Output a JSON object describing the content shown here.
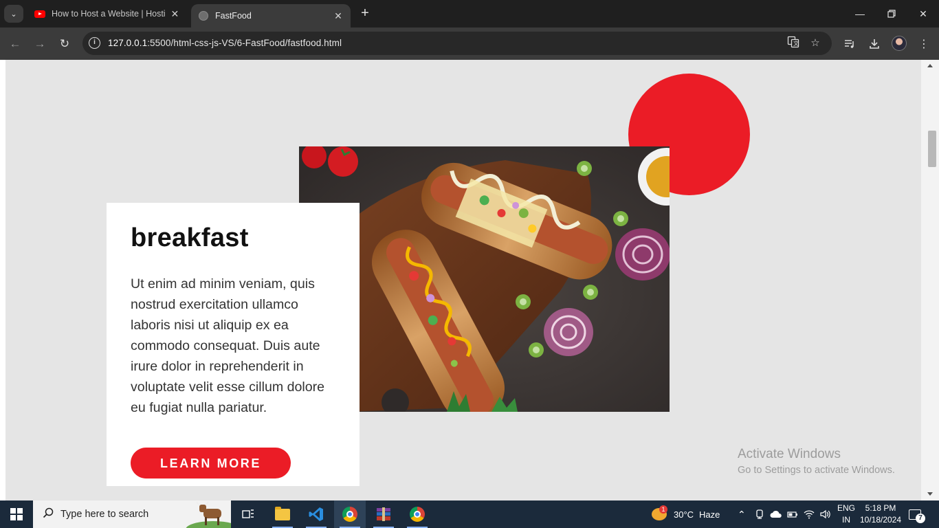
{
  "browser": {
    "tabs": [
      {
        "title": "How to Host a Website | Hostin",
        "favicon": "youtube-icon",
        "active": false
      },
      {
        "title": "FastFood",
        "favicon": "globe-icon",
        "active": true
      }
    ],
    "url_host": "127.0.0.1",
    "url_path": ":5500/html-css-js-VS/6-FastFood/fastfood.html"
  },
  "page": {
    "card": {
      "title": "breakfast",
      "text": "Ut enim ad minim veniam, quis nostrud exercitation ullamco laboris nisi ut aliquip ex ea commodo consequat. Duis aute irure dolor in reprehenderit in voluptate velit esse cillum dolore eu fugiat nulla pariatur.",
      "button_label": "LEARN MORE"
    },
    "colors": {
      "accent": "#eb1c26",
      "background": "#e5e5e5"
    }
  },
  "overlay": {
    "activate_title": "Activate Windows",
    "activate_sub": "Go to Settings to activate Windows."
  },
  "taskbar": {
    "search_placeholder": "Type here to search",
    "weather_temp": "30°C",
    "weather_desc": "Haze",
    "weather_badge": "1",
    "lang_top": "ENG",
    "lang_bottom": "IN",
    "time": "5:18 PM",
    "date": "10/18/2024",
    "notification_count": "7"
  }
}
